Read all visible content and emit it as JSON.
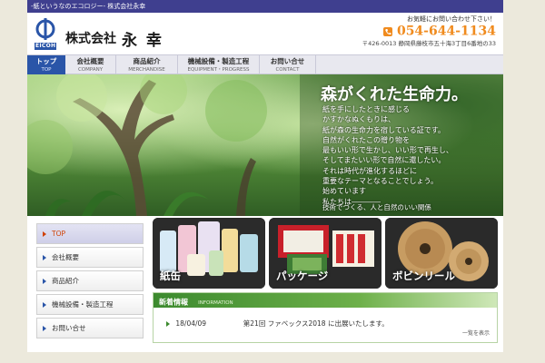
{
  "topstrip": {
    "text": "-紙というなのエコロジー- 株式会社永幸"
  },
  "header": {
    "logo_letters": "EICOH",
    "company_prefix": "株式会社",
    "company_name": "永 幸",
    "contact_lead": "お気軽にお問い合わせ下さい！",
    "phone": "054-644-1134",
    "address": "〒426-0013 静岡県藤枝市五十海3丁目6番地の33"
  },
  "nav": [
    {
      "ja": "トップ",
      "en": "TOP",
      "active": true
    },
    {
      "ja": "会社概要",
      "en": "COMPANY",
      "active": false
    },
    {
      "ja": "商品紹介",
      "en": "MERCHANDISE",
      "active": false
    },
    {
      "ja": "機械設備・製造工程",
      "en": "EQUIPMENT・PROGRESS",
      "active": false
    },
    {
      "ja": "お問い合せ",
      "en": "CONTACT",
      "active": false
    }
  ],
  "hero": {
    "title": "森がくれた生命力。",
    "lines": [
      "紙を手にしたときに感じる",
      "かすかなぬくもりは、",
      "紙が森の生命力を宿している証です。",
      "自然がくれたこの贈り物を",
      "最もいい形で生かし、いい形で再生し、",
      "そしてまたいい形で自然に還したい。",
      "それは時代が進化するほどに",
      "重要なテーマとなることでしょう。",
      "始めています",
      "私たちは――――"
    ],
    "tagline": "技術でつくる、人と自然のいい関係"
  },
  "sidebar": [
    {
      "label": "TOP",
      "active": true
    },
    {
      "label": "会社概要",
      "active": false
    },
    {
      "label": "商品紹介",
      "active": false
    },
    {
      "label": "機械設備・製造工程",
      "active": false
    },
    {
      "label": "お問い合せ",
      "active": false
    }
  ],
  "products": [
    {
      "label": "紙缶"
    },
    {
      "label": "パッケージ"
    },
    {
      "label": "ボビンリール"
    }
  ],
  "news": {
    "title": "新着情報",
    "title_en": "INFORMATION",
    "items": [
      {
        "date": "18/04/09",
        "text": "第21回 ファベックス2018 に出展いたします。"
      }
    ],
    "more": "一覧を表示"
  },
  "colors": {
    "topstrip": "#3f3f8f",
    "nav_active": "#2a55a8",
    "phone": "#f08b1e",
    "news_green": "#3c8a2e",
    "sidebar_active_text": "#d04000"
  }
}
